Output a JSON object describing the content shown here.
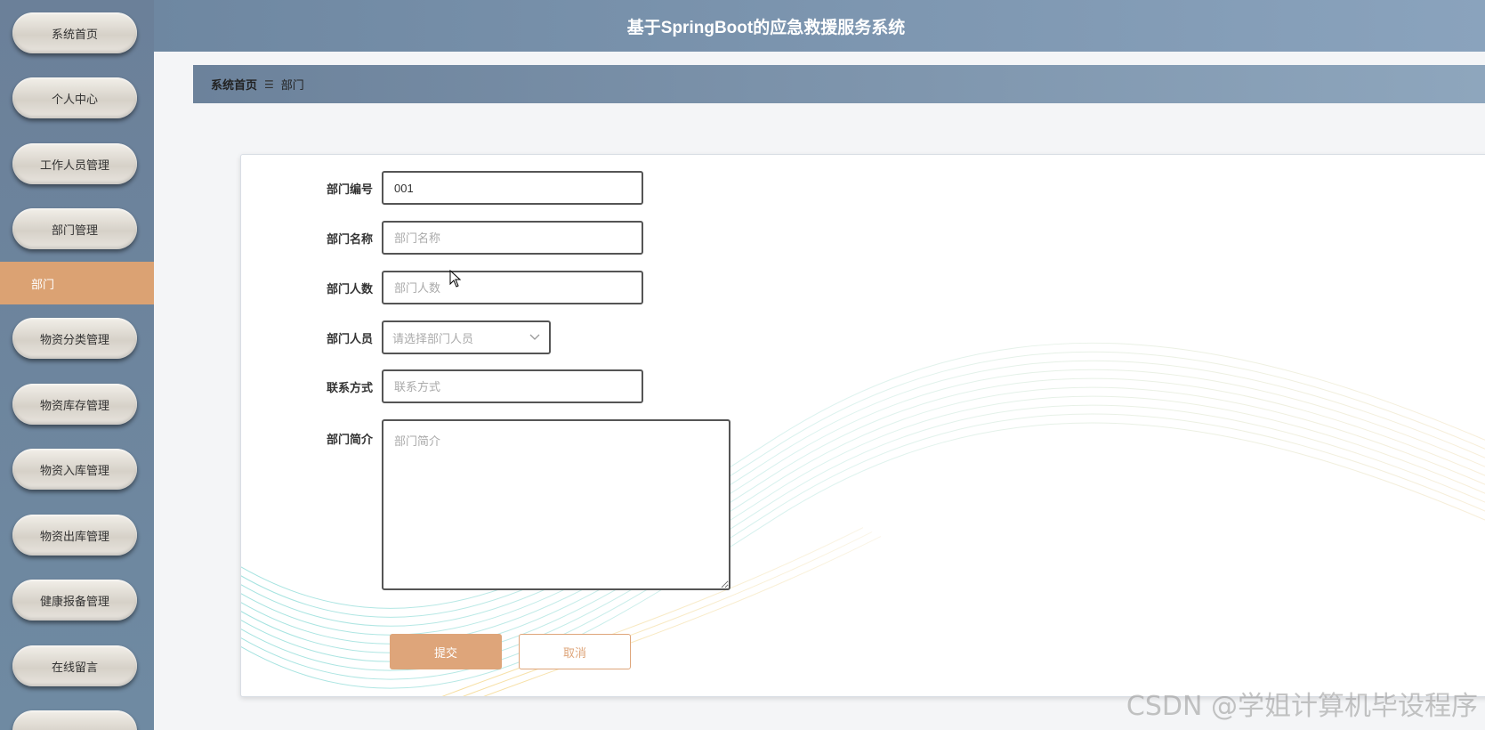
{
  "app": {
    "title": "基于SpringBoot的应急救援服务系统"
  },
  "sidebar": {
    "items": [
      {
        "label": "系统首页"
      },
      {
        "label": "个人中心"
      },
      {
        "label": "工作人员管理"
      },
      {
        "label": "部门管理"
      },
      {
        "label": "部门",
        "active": true
      },
      {
        "label": "物资分类管理"
      },
      {
        "label": "物资库存管理"
      },
      {
        "label": "物资入库管理"
      },
      {
        "label": "物资出库管理"
      },
      {
        "label": "健康报备管理"
      },
      {
        "label": "在线留言"
      }
    ]
  },
  "breadcrumb": {
    "home": "系统首页",
    "separator": "☰",
    "current": "部门"
  },
  "form": {
    "dept_no": {
      "label": "部门编号",
      "value": "001"
    },
    "dept_name": {
      "label": "部门名称",
      "placeholder": "部门名称"
    },
    "dept_count": {
      "label": "部门人数",
      "placeholder": "部门人数"
    },
    "dept_member": {
      "label": "部门人员",
      "placeholder": "请选择部门人员"
    },
    "contact": {
      "label": "联系方式",
      "placeholder": "联系方式"
    },
    "intro": {
      "label": "部门简介",
      "placeholder": "部门简介"
    },
    "submit_label": "提交",
    "cancel_label": "取消"
  },
  "watermark": "CSDN @学姐计算机毕设程序",
  "colors": {
    "accent": "#dea57a",
    "sidebar": "#6b8099",
    "header": "#7a93ad"
  }
}
